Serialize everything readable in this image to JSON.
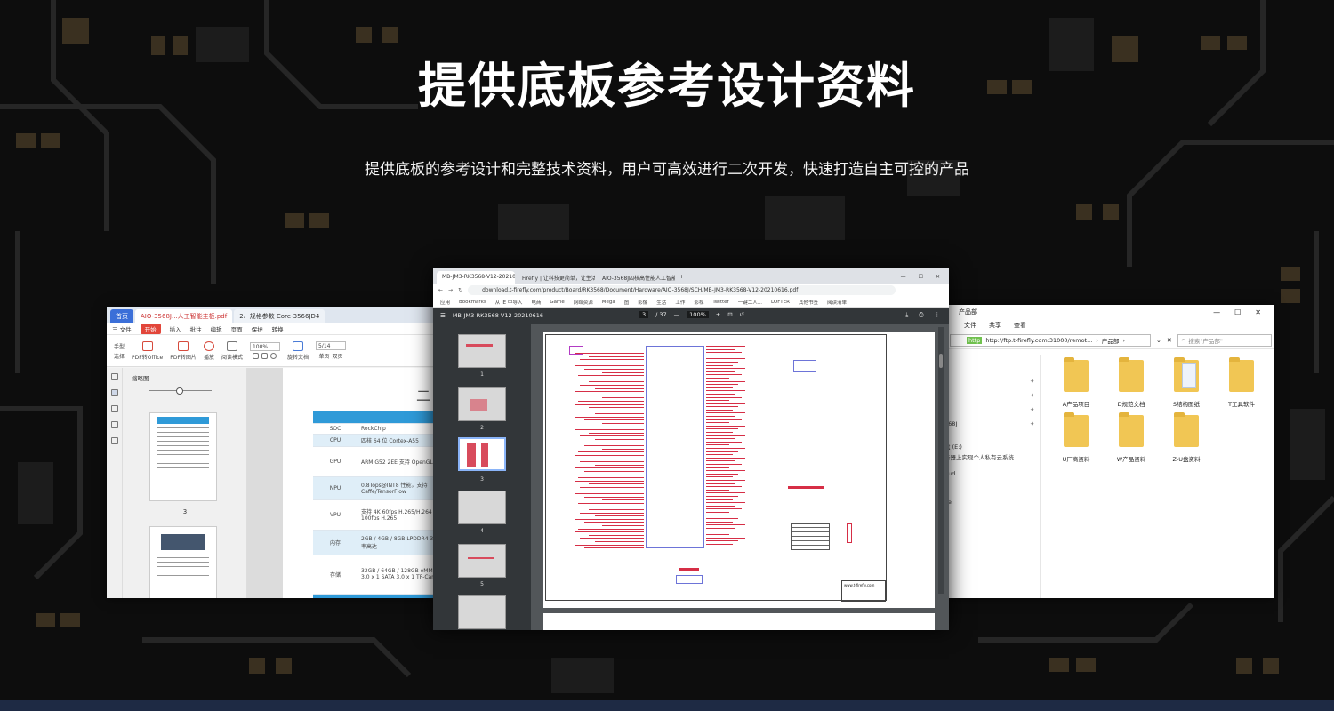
{
  "heading": "提供底板参考设计资料",
  "subheading": "提供底板的参考设计和完整技术资料，用户可高效进行二次开发，快速打造自主可控的产品",
  "colors": {
    "accent_blue": "#2f9ad8",
    "schematic_red": "#d62e46",
    "folder_yellow": "#f1c654",
    "pcb_gold": "#b08a3a"
  },
  "left_window": {
    "tabs": [
      "首页",
      "AIO-3568J...人工智能主板.pdf",
      "2、规格参数 Core-3566JD4"
    ],
    "menu": [
      "三 文件",
      "开始",
      "插入",
      "批注",
      "编辑",
      "页面",
      "保护",
      "转换"
    ],
    "toolbar": {
      "hand": "手型",
      "select": "选择",
      "pdf_office": "PDF转Office",
      "pdf_image": "PDF转图片",
      "play": "播放",
      "read_mode": "阅读模式",
      "zoom": "100%",
      "rotate": "旋转文档",
      "single": "单页",
      "double": "双页",
      "page_input": "5/14"
    },
    "thumbs_title": "缩略图",
    "page_numbers": [
      "3"
    ],
    "doc_title": "二",
    "spec_rows": [
      {
        "k": "SOC",
        "v": "RockChip"
      },
      {
        "k": "CPU",
        "v": "四核 64 位 Cortex-A55"
      },
      {
        "k": "GPU",
        "v": "ARM G52 2EE 支持 OpenGL ES 1.1/2.0"
      },
      {
        "k": "NPU",
        "v": "0.8Tops@INT8 性能，支持 Caffe/TensorFlow"
      },
      {
        "k": "VPU",
        "v": "支持 4K 60fps H.265/H.264 支持 1080P 100fps H.265"
      },
      {
        "k": "内存",
        "v": "2GB / 4GB / 8GB LPDDR4 32bit 位宽，频率高达"
      },
      {
        "k": "存储",
        "v": "32GB / 64GB / 128GB eMMC M.2 PCIe 3.0 x 1 SATA 3.0 x 1 TF-Card Slot x1"
      }
    ]
  },
  "center_window": {
    "tabs": [
      "MB-JM3-RK3568-V12-20210...",
      "Firefly | 让科技更简单，让生活更...",
      "AIO-3568J四核高性能人工智能..."
    ],
    "url": "download.t-firefly.com/product/Board/RK3568/Document/Hardware/AIO-3568J/SCH/MB-JM3-RK3568-V12-20210616.pdf",
    "bookmarks": [
      "应用",
      "Bookmarks",
      "从 IE 中导入",
      "电商",
      "Game",
      "网络资源",
      "Mega",
      "图",
      "影像",
      "生活",
      "工作",
      "影视",
      "Twitter",
      "一键二人...",
      "LOFTER",
      "其他书签",
      "阅读清单"
    ],
    "pdf_title": "MB-JM3-RK3568-V12-20210616",
    "page_current": "3",
    "page_total": "/ 37",
    "zoom": "100%",
    "thumb_numbers": [
      "1",
      "2",
      "3",
      "4",
      "5"
    ],
    "titleblock": "www.t-firefly.com"
  },
  "right_window": {
    "title": "产品部",
    "ribbon": [
      "文件",
      "共享",
      "查看"
    ],
    "address": "http://ftp.t-firefly.com:31000/remot...",
    "address_hl": "http",
    "breadcrumb_last": "产品部",
    "search_placeholder": "搜索\"产品部\"",
    "sidebar": [
      "568J",
      "盘 (E:)",
      "务器上实现个人私有云系统",
      "oud",
      "ve",
      "e"
    ],
    "folders": [
      {
        "name": "A产品项目",
        "docs": false
      },
      {
        "name": "D规范文档",
        "docs": false
      },
      {
        "name": "S结构图纸",
        "docs": true
      },
      {
        "name": "T工具软件",
        "docs": false
      },
      {
        "name": "U厂商资料",
        "docs": false
      },
      {
        "name": "W产品资料",
        "docs": false
      },
      {
        "name": "Z-U盘资料",
        "docs": false
      }
    ]
  }
}
